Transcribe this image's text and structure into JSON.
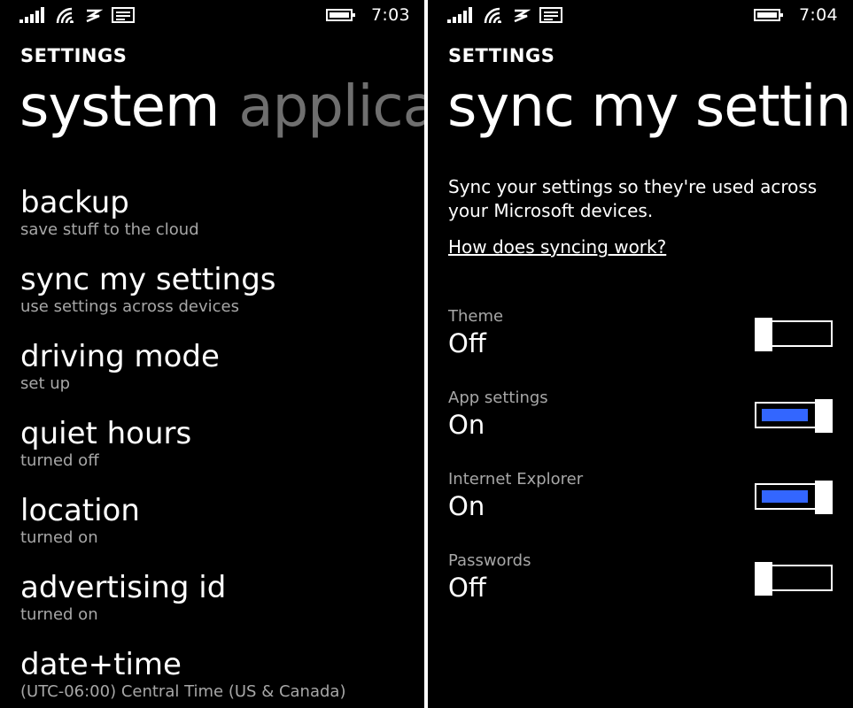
{
  "colors": {
    "background": "#000000",
    "text": "#ffffff",
    "secondary_text": "#a7a7a7",
    "inactive_pivot": "#6f6f6f",
    "accent": "#3366ff"
  },
  "left": {
    "status": {
      "time": "7:03",
      "icons": [
        "signal-strength-icon",
        "wifi-icon",
        "data-connection-icon",
        "message-icon",
        "battery-icon"
      ]
    },
    "app_title": "SETTINGS",
    "pivots": [
      {
        "label": "system",
        "active": true
      },
      {
        "label": "applicat",
        "active": false
      }
    ],
    "items": [
      {
        "title": "backup",
        "subtitle": "save stuff to the cloud"
      },
      {
        "title": "sync my settings",
        "subtitle": "use settings across devices"
      },
      {
        "title": "driving mode",
        "subtitle": "set up"
      },
      {
        "title": "quiet hours",
        "subtitle": "turned off"
      },
      {
        "title": "location",
        "subtitle": "turned on"
      },
      {
        "title": "advertising id",
        "subtitle": "turned on"
      },
      {
        "title": "date+time",
        "subtitle": "(UTC-06:00) Central Time (US & Canada)"
      }
    ]
  },
  "right": {
    "status": {
      "time": "7:04",
      "icons": [
        "signal-strength-icon",
        "wifi-icon",
        "data-connection-icon",
        "message-icon",
        "battery-icon"
      ]
    },
    "app_title": "SETTINGS",
    "page_title": "sync my setting",
    "description": "Sync your settings so they're used across your Microsoft devices.",
    "help_link": "How does syncing work?",
    "settings": [
      {
        "label": "Theme",
        "value": "Off",
        "on": false
      },
      {
        "label": "App settings",
        "value": "On",
        "on": true
      },
      {
        "label": "Internet Explorer",
        "value": "On",
        "on": true
      },
      {
        "label": "Passwords",
        "value": "Off",
        "on": false
      }
    ]
  }
}
